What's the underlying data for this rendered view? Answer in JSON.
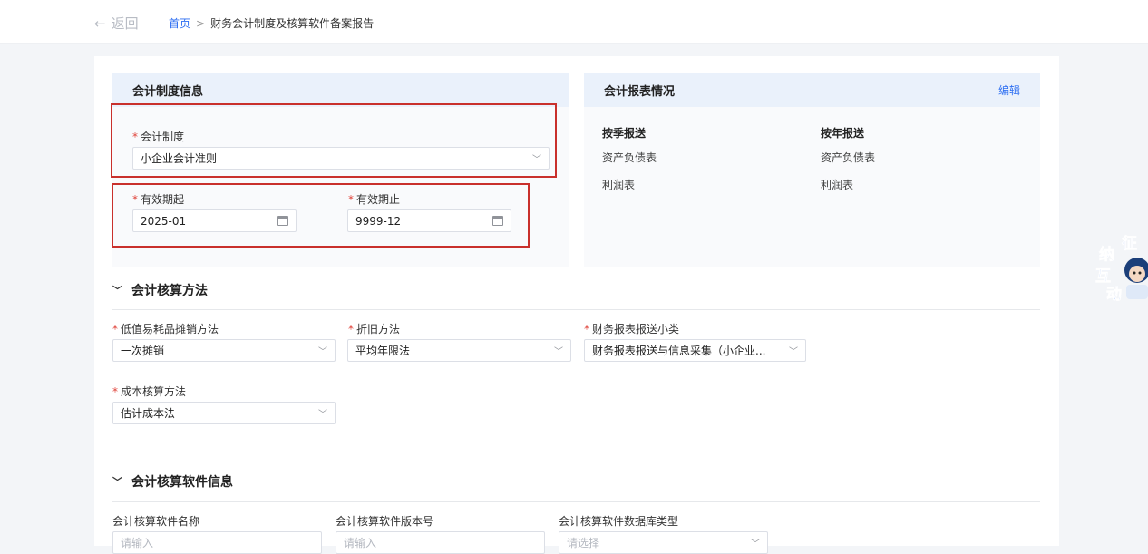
{
  "header": {
    "back_label": "返回",
    "breadcrumb_home": "首页",
    "breadcrumb_separator": ">",
    "breadcrumb_current": "财务会计制度及核算软件备案报告"
  },
  "system_info": {
    "title": "会计制度信息",
    "system_label": "会计制度",
    "system_value": "小企业会计准则",
    "valid_from_label": "有效期起",
    "valid_from_value": "2025-01",
    "valid_to_label": "有效期止",
    "valid_to_value": "9999-12"
  },
  "report_info": {
    "title": "会计报表情况",
    "edit_label": "编辑",
    "quarterly_title": "按季报送",
    "quarterly_items": [
      "资产负债表",
      "利润表"
    ],
    "annual_title": "按年报送",
    "annual_items": [
      "资产负债表",
      "利润表"
    ]
  },
  "method_section": {
    "title": "会计核算方法",
    "low_value_label": "低值易耗品摊销方法",
    "low_value_value": "一次摊销",
    "depreciation_label": "折旧方法",
    "depreciation_value": "平均年限法",
    "report_category_label": "财务报表报送小类",
    "report_category_value": "财务报表报送与信息采集（小企业...",
    "cost_label": "成本核算方法",
    "cost_value": "估计成本法"
  },
  "software_section": {
    "title": "会计核算软件信息",
    "name_label": "会计核算软件名称",
    "name_placeholder": "请输入",
    "version_label": "会计核算软件版本号",
    "version_placeholder": "请输入",
    "db_label": "会计核算软件数据库类型",
    "db_placeholder": "请选择"
  },
  "badge": {
    "chars": [
      "纳",
      "征",
      "互",
      "动"
    ]
  },
  "colors": {
    "accent": "#2c6ef2",
    "required": "#e0433a",
    "highlight_box": "#c9302c",
    "panel_header": "#eaf1fb"
  }
}
